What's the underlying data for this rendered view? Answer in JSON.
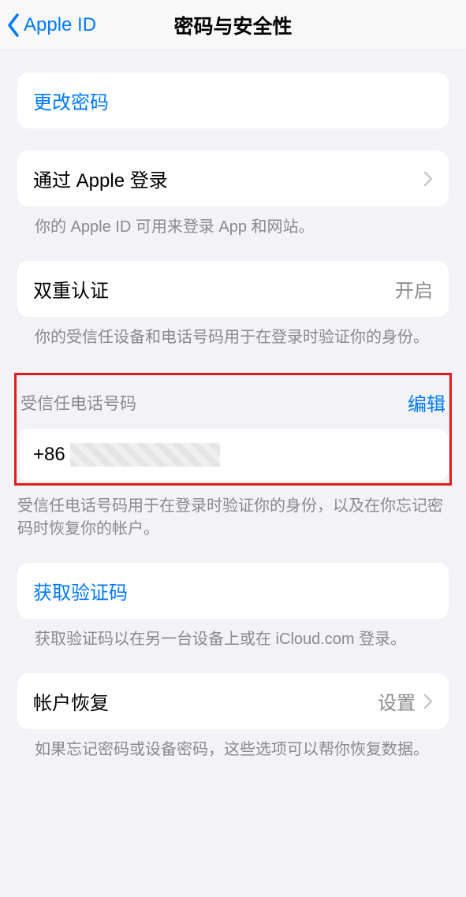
{
  "nav": {
    "back_label": "Apple ID",
    "title": "密码与安全性"
  },
  "change_password": {
    "label": "更改密码"
  },
  "sign_in_with_apple": {
    "label": "通过 Apple 登录",
    "footer": "你的 Apple ID 可用来登录 App 和网站。"
  },
  "two_factor": {
    "label": "双重认证",
    "value": "开启",
    "footer": "你的受信任设备和电话号码用于在登录时验证你的身份。"
  },
  "trusted_phone": {
    "header": "受信任电话号码",
    "edit": "编辑",
    "prefix": "+86",
    "footer": "受信任电话号码用于在登录时验证你的身份，以及在你忘记密码时恢复你的帐户。"
  },
  "get_code": {
    "label": "获取验证码",
    "footer": "获取验证码以在另一台设备上或在 iCloud.com 登录。"
  },
  "account_recovery": {
    "label": "帐户恢复",
    "value": "设置",
    "footer": "如果忘记密码或设备密码，这些选项可以帮你恢复数据。"
  }
}
